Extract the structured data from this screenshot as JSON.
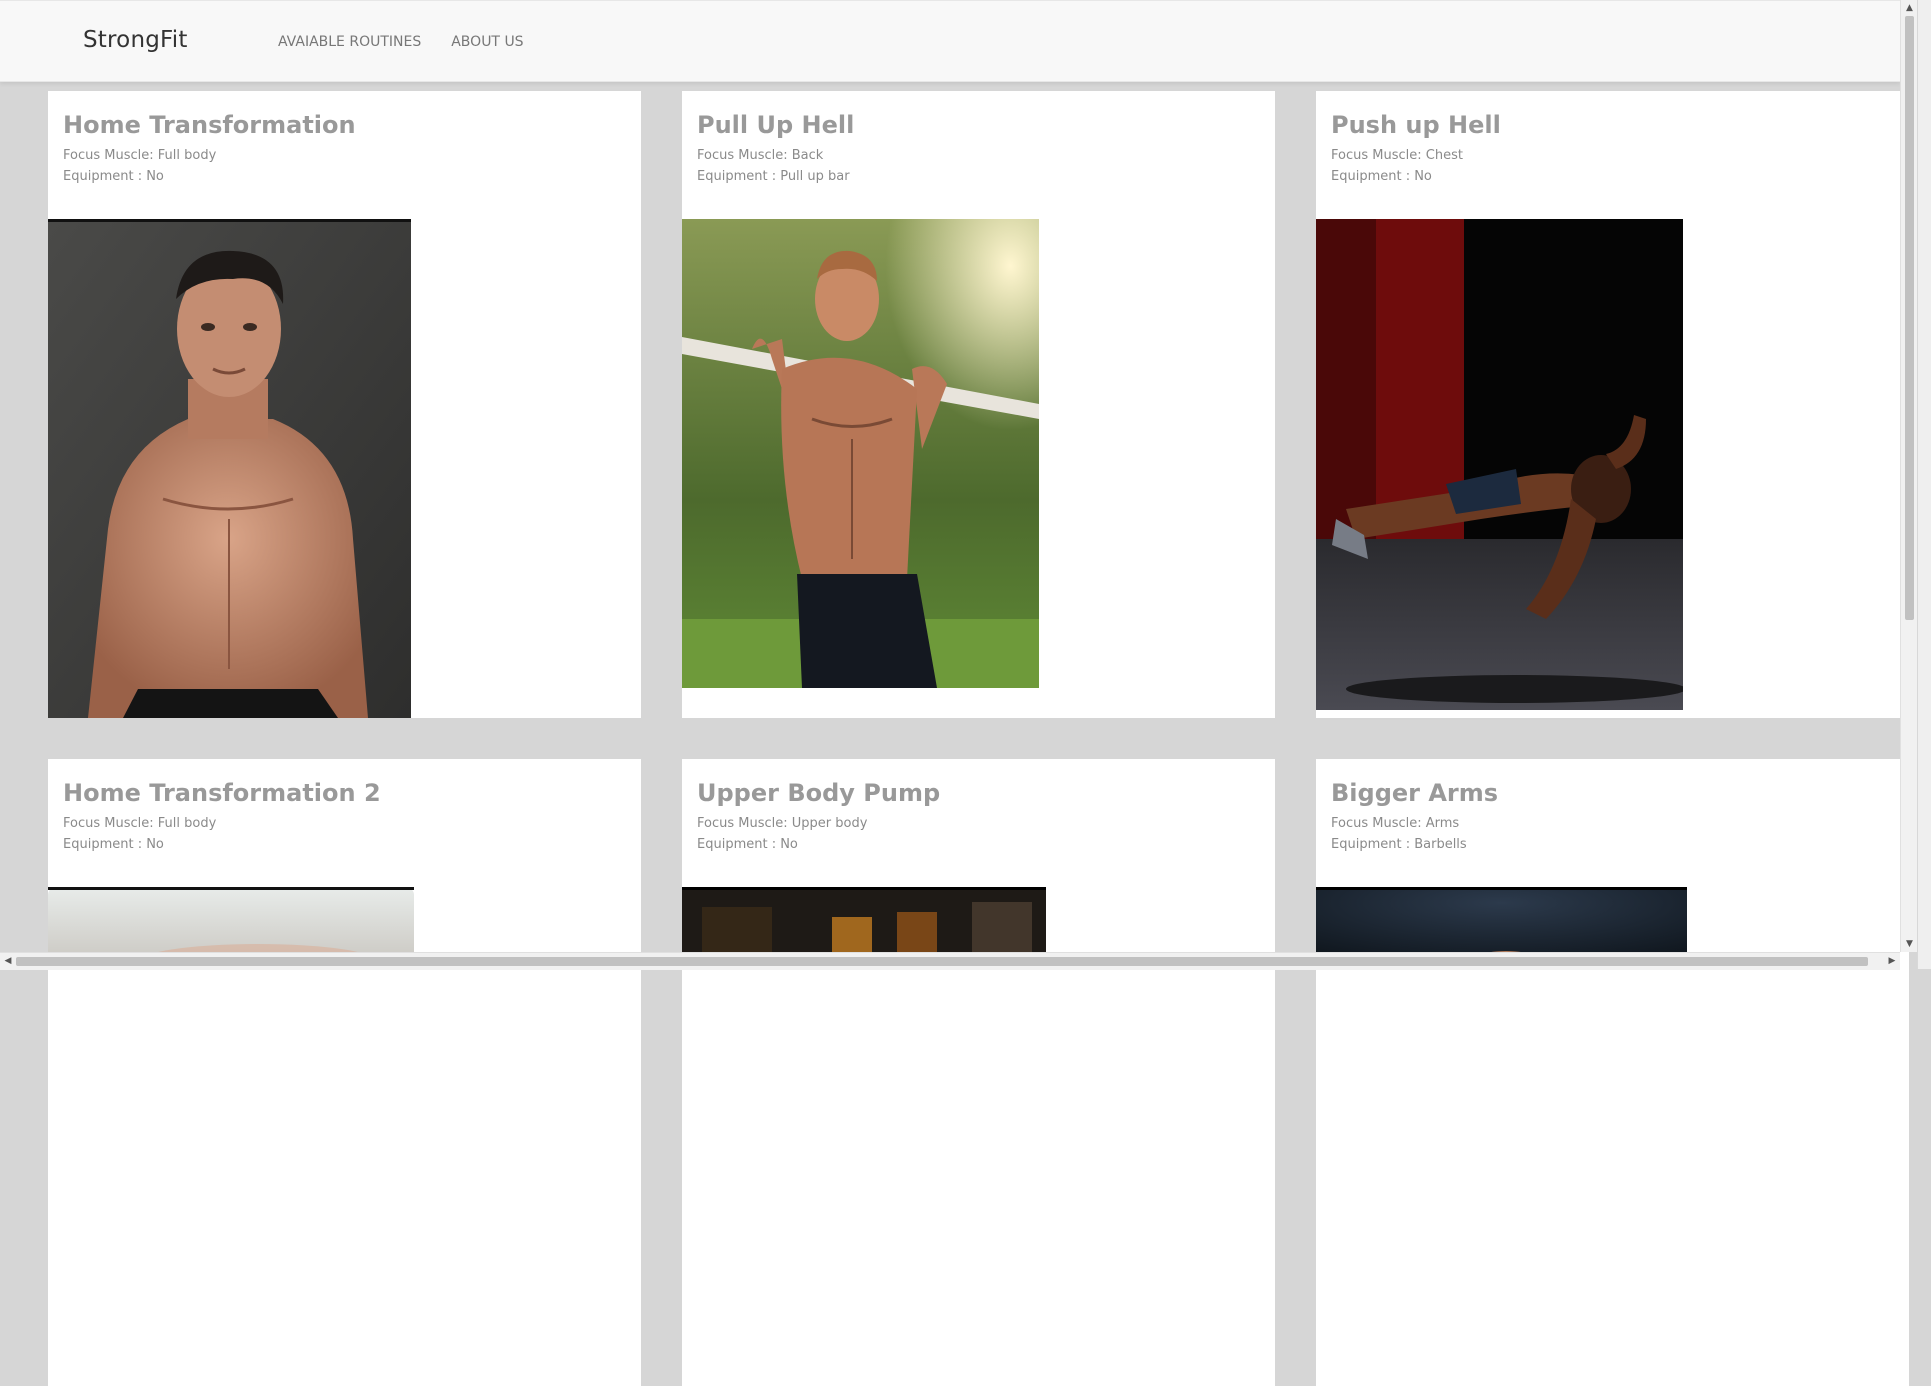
{
  "navbar": {
    "brand": "StrongFit",
    "links": [
      "AVAIABLE ROUTINES",
      "ABOUT US"
    ]
  },
  "cards": [
    {
      "title": "Home Transformation",
      "focus": "Focus Muscle: Full body",
      "equipment": "Equipment : No"
    },
    {
      "title": "Pull Up Hell",
      "focus": "Focus Muscle: Back",
      "equipment": "Equipment : Pull up bar"
    },
    {
      "title": "Push up Hell",
      "focus": "Focus Muscle: Chest",
      "equipment": "Equipment : No"
    },
    {
      "title": "Home Transformation 2",
      "focus": "Focus Muscle: Full body",
      "equipment": "Equipment : No"
    },
    {
      "title": "Upper Body Pump",
      "focus": "Focus Muscle: Upper body",
      "equipment": "Equipment : No"
    },
    {
      "title": "Bigger Arms",
      "focus": "Focus Muscle: Arms",
      "equipment": "Equipment : Barbells"
    }
  ],
  "scrollbars": {
    "up_arrow": "▲",
    "down_arrow": "▼",
    "left_arrow": "◀",
    "right_arrow": "▶"
  },
  "colors": {
    "page_background": "#d6d6d6",
    "navbar_background": "#f8f8f8",
    "card_title": "#999999"
  }
}
